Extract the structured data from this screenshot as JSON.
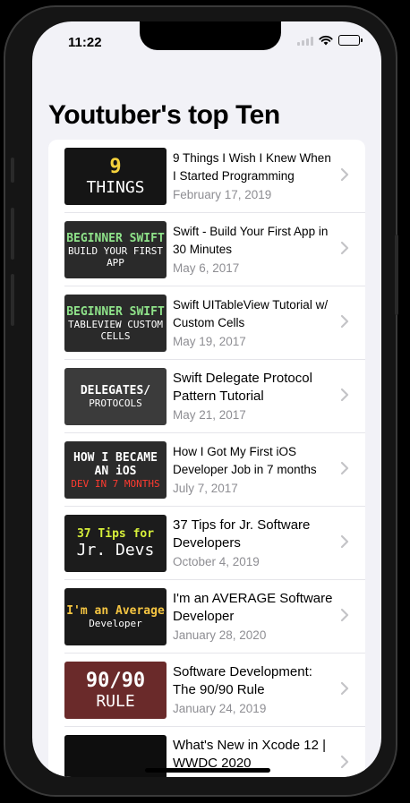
{
  "status_bar": {
    "time": "11:22"
  },
  "title": "Youtuber's top Ten",
  "colors": {
    "accent": "#ff3b30",
    "secondary_text": "#8e8e93"
  },
  "videos": [
    {
      "title": "9 Things I Wish I Knew When I Started Programming",
      "date": "February 17, 2019",
      "thumb_line1": "9",
      "thumb_line2": "THINGS",
      "thumb_bg": "#151515",
      "thumb_c1": "#f5d23c",
      "thumb_c2": "#ffffff"
    },
    {
      "title": "Swift - Build Your First App in 30 Minutes",
      "date": "May 6, 2017",
      "thumb_line1": "BEGINNER SWIFT",
      "thumb_line2": "BUILD YOUR FIRST APP",
      "thumb_bg": "#2a2a2a",
      "thumb_c1": "#8fe38a",
      "thumb_c2": "#ffffff"
    },
    {
      "title": "Swift UITableView Tutorial w/ Custom Cells",
      "date": "May 19, 2017",
      "thumb_line1": "BEGINNER SWIFT",
      "thumb_line2": "TABLEVIEW CUSTOM CELLS",
      "thumb_bg": "#2a2a2a",
      "thumb_c1": "#8fe38a",
      "thumb_c2": "#ffffff"
    },
    {
      "title": "Swift Delegate Protocol Pattern Tutorial",
      "date": "May 21, 2017",
      "thumb_line1": "DELEGATES/",
      "thumb_line2": "PROTOCOLS",
      "thumb_bg": "#3b3b3b",
      "thumb_c1": "#ffffff",
      "thumb_c2": "#ffffff"
    },
    {
      "title": "How I Got My First iOS Developer Job in 7 months",
      "date": "July 7, 2017",
      "thumb_line1": "HOW I BECAME AN iOS",
      "thumb_line2": "DEV IN 7 MONTHS",
      "thumb_bg": "#2b2b2b",
      "thumb_c1": "#ffffff",
      "thumb_c2": "#ff3b30"
    },
    {
      "title": "37 Tips for Jr. Software Developers",
      "date": "October 4, 2019",
      "thumb_line1": "37 Tips for",
      "thumb_line2": "Jr. Devs",
      "thumb_bg": "#1c1c1c",
      "thumb_c1": "#d7ef3a",
      "thumb_c2": "#ffffff"
    },
    {
      "title": "I'm an AVERAGE Software Developer",
      "date": "January 28, 2020",
      "thumb_line1": "I'm an Average",
      "thumb_line2": "Developer",
      "thumb_bg": "#1a1a1a",
      "thumb_c1": "#f5c542",
      "thumb_c2": "#ffffff"
    },
    {
      "title": "Software Development: The 90/90 Rule",
      "date": "January 24, 2019",
      "thumb_line1": "90/90",
      "thumb_line2": "RULE",
      "thumb_bg": "#6a2a2a",
      "thumb_c1": "#ffffff",
      "thumb_c2": "#ffffff"
    },
    {
      "title": "What's New in Xcode 12 | WWDC 2020",
      "date": "",
      "thumb_line1": "",
      "thumb_line2": "",
      "thumb_bg": "#0e0e0e",
      "thumb_c1": "#5ac8fa",
      "thumb_c2": "#ffffff"
    }
  ]
}
